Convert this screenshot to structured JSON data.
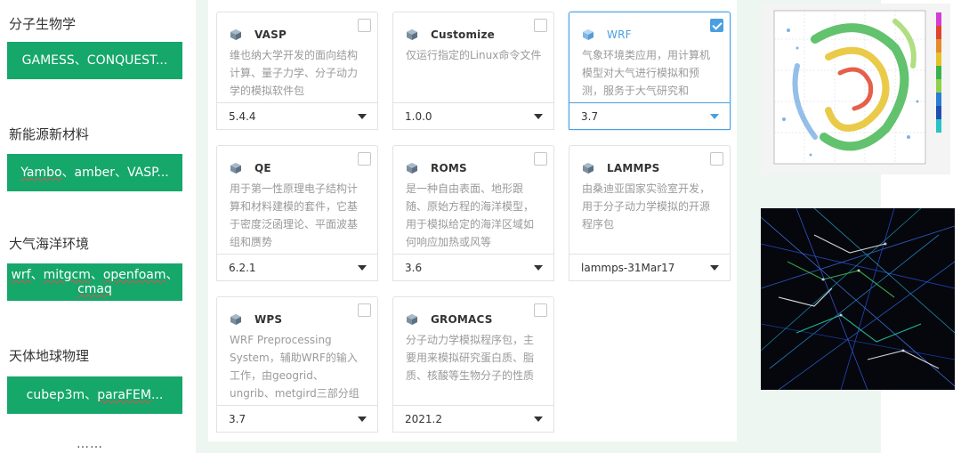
{
  "categories": [
    {
      "label": "分子生物学",
      "tools": "GAMESS、CONQUEST..."
    },
    {
      "label": "新能源新材料",
      "tools_parts": [
        "Yambo",
        "、amber、VASP..."
      ]
    },
    {
      "label": "大气海洋环境",
      "tools_line1_parts": [
        "wrf",
        "、",
        "mitgcm",
        "、",
        "openfoam",
        "、"
      ],
      "tools_line2": "cmaq"
    },
    {
      "label": "天体地球物理",
      "tools_parts": [
        "cubep3m、",
        "paraFEM",
        "..."
      ]
    }
  ],
  "more": "……",
  "apps": [
    {
      "name": "VASP",
      "desc": "维也纳大学开发的面向结构计算、量子力学、分子动力学的模拟软件包",
      "version": "5.4.4",
      "selected": false
    },
    {
      "name": "Customize",
      "desc": "仅运行指定的Linux命令文件",
      "version": "1.0.0",
      "selected": false
    },
    {
      "name": "WRF",
      "desc": "气象环境类应用，用计算机模型对大气进行模拟和预测，服务于大气研究和",
      "version": "3.7",
      "selected": true
    },
    {
      "name": "QE",
      "desc": "用于第一性原理电子结构计算和材料建模的套件，它基于密度泛函理论、平面波基组和赝势",
      "version": "6.2.1",
      "selected": false
    },
    {
      "name": "ROMS",
      "desc": "是一种自由表面、地形跟随、原始方程的海洋模型，用于模拟给定的海洋区域如何响应加热或风等",
      "version": "3.6",
      "selected": false
    },
    {
      "name": "LAMMPS",
      "desc": "由桑迪亚国家实验室开发，用于分子动力学模拟的开源程序包",
      "version": "lammps-31Mar17",
      "selected": false
    },
    {
      "name": "WPS",
      "desc": "WRF Preprocessing System，辅助WRF的输入工作，由geogrid、ungrib、metgird三部分组",
      "version": "3.7",
      "selected": false
    },
    {
      "name": "GROMACS",
      "desc": "分子动力学模拟程序包，主要用来模拟研究蛋白质、脂质、核酸等生物分子的性质",
      "version": "2021.2",
      "selected": false
    }
  ],
  "colors": {
    "accent_green": "#16a76a",
    "selected_blue": "#4a9fe0"
  },
  "icons": {
    "app": "cube-icon",
    "select": "chevron-down-icon"
  }
}
